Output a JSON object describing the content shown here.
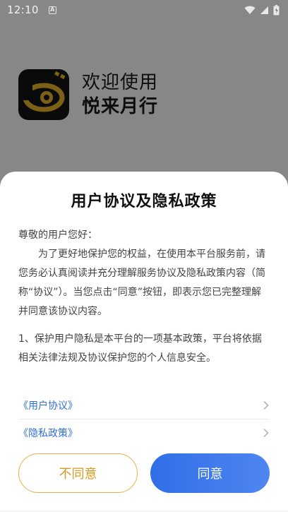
{
  "status_bar": {
    "time": "12:10",
    "left_badge": "A"
  },
  "app": {
    "welcome": "欢迎使用",
    "name": "悦来月行"
  },
  "dialog": {
    "title": "用户协议及隐私政策",
    "greeting": "尊敬的用户您好：",
    "paragraph1": "为了更好地保护您的权益，在使用本平台服务前，请您务必认真阅读并充分理解服务协议及隐私政策内容（简称“协议”）。当您点击“同意”按钮，即表示您已完整理解并同意该协议内容。",
    "paragraph2": "1、保护用户隐私是本平台的一项基本政策，平台将依据相关法律法规及协议保护您的个人信息安全。",
    "links": [
      {
        "label": "《用户协议》"
      },
      {
        "label": "《隐私政策》"
      }
    ],
    "disagree_label": "不同意",
    "agree_label": "同意"
  },
  "colors": {
    "accent_blue": "#2f6fe8",
    "link_blue": "#2f6fd4",
    "disagree_orange": "#d99a22",
    "logo_gold": "#e9b52b"
  }
}
